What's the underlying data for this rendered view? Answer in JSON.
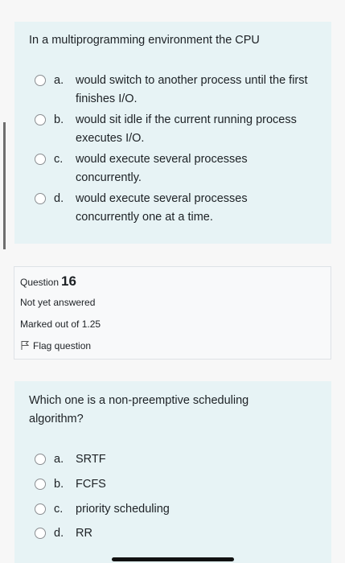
{
  "question15": {
    "text": "In a multiprogramming environment the CPU",
    "options": [
      {
        "letter": "a.",
        "text": "would switch to another process until the first finishes I/O."
      },
      {
        "letter": "b.",
        "text": "would sit idle if the current running process executes I/O."
      },
      {
        "letter": "c.",
        "text": "would execute several processes concurrently."
      },
      {
        "letter": "d.",
        "text": "would execute several processes concurrently one at a time."
      }
    ]
  },
  "question16_info": {
    "question_label": "Question",
    "question_number": "16",
    "status": "Not yet answered",
    "marks": "Marked out of 1.25",
    "flag_label": "Flag question",
    "flag_icon": "flag-icon"
  },
  "question16": {
    "text": "Which one is a non-preemptive scheduling algorithm?",
    "options": [
      {
        "letter": "a.",
        "text": "SRTF"
      },
      {
        "letter": "b.",
        "text": "FCFS"
      },
      {
        "letter": "c.",
        "text": "priority scheduling"
      },
      {
        "letter": "d.",
        "text": "RR"
      }
    ]
  },
  "colors": {
    "question_bg": "#e7f3f5",
    "info_bg": "#f8f9fa",
    "border": "#dee2e6"
  }
}
